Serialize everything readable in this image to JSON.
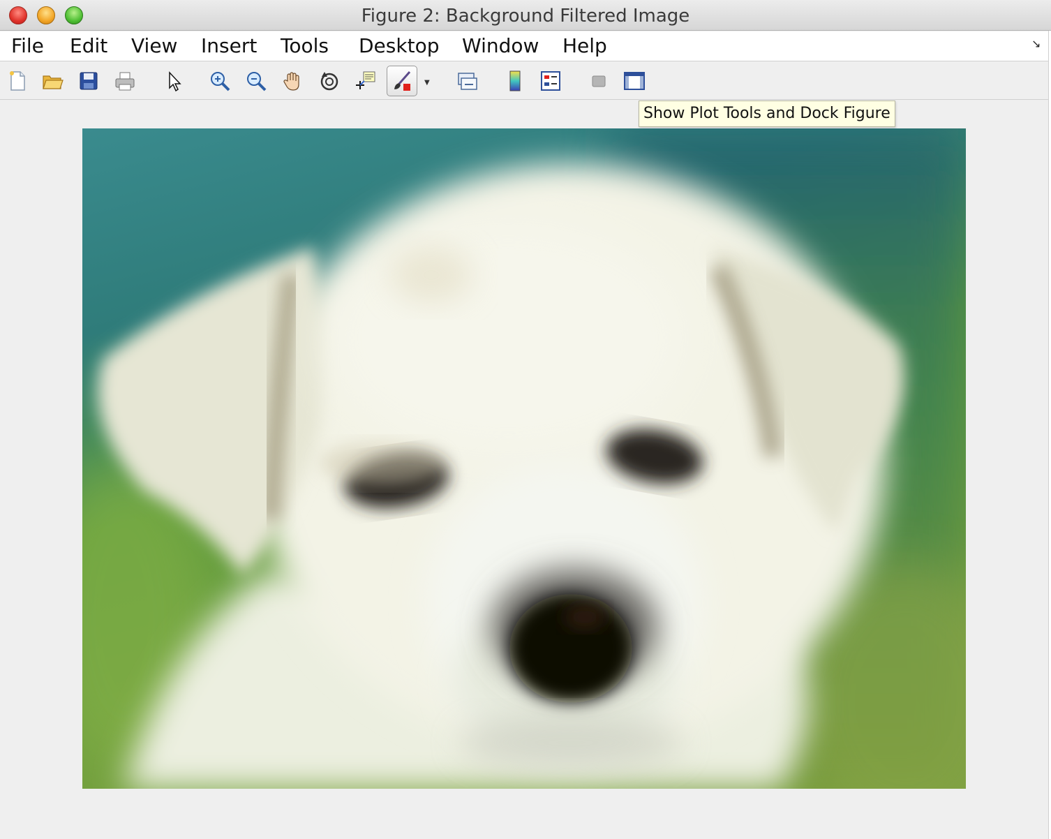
{
  "window": {
    "title": "Figure 2: Background Filtered Image"
  },
  "menubar": {
    "items": [
      "File",
      "Edit",
      "View",
      "Insert",
      "Tools",
      "Desktop",
      "Window",
      "Help"
    ]
  },
  "toolbar": {
    "buttons": [
      {
        "icon": "new-figure-icon"
      },
      {
        "icon": "open-file-icon"
      },
      {
        "icon": "save-figure-icon"
      },
      {
        "icon": "print-figure-icon"
      },
      {
        "icon": "edit-plot-arrow-icon"
      },
      {
        "icon": "zoom-in-icon"
      },
      {
        "icon": "zoom-out-icon"
      },
      {
        "icon": "pan-hand-icon"
      },
      {
        "icon": "rotate-3d-icon"
      },
      {
        "icon": "data-cursor-icon"
      },
      {
        "icon": "brush-data-icon",
        "pressed": true
      },
      {
        "icon": "link-plot-icon"
      },
      {
        "icon": "insert-colorbar-icon"
      },
      {
        "icon": "insert-legend-icon"
      },
      {
        "icon": "hide-plot-tools-icon"
      },
      {
        "icon": "show-plot-tools-icon"
      }
    ]
  },
  "tooltip": {
    "text": "Show Plot Tools and Dock Figure"
  },
  "image": {
    "subject": "blurred white puppy face on teal-to-green background",
    "colors": {
      "background_top": "#2f7f86",
      "background_bottom": "#6a9a35",
      "fur": "#f0f0e2"
    }
  }
}
